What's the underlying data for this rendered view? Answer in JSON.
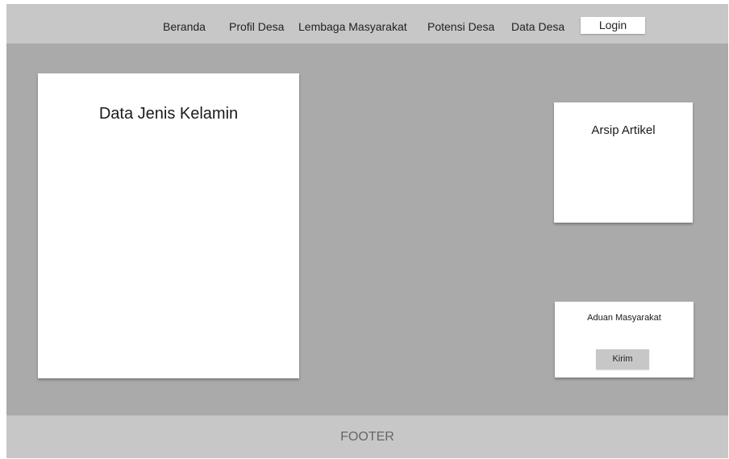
{
  "nav": {
    "items": [
      {
        "label": "Beranda"
      },
      {
        "label": "Profil Desa"
      },
      {
        "label": "Lembaga Masyarakat"
      },
      {
        "label": "Potensi Desa"
      },
      {
        "label": "Data Desa"
      }
    ],
    "login_label": "Login"
  },
  "main": {
    "gender_card_title": "Data Jenis Kelamin"
  },
  "sidebar": {
    "archive_title": "Arsip Artikel",
    "complaint_title": "Aduan Masyarakat",
    "send_label": "Kirim"
  },
  "footer": {
    "label": "FOOTER"
  }
}
